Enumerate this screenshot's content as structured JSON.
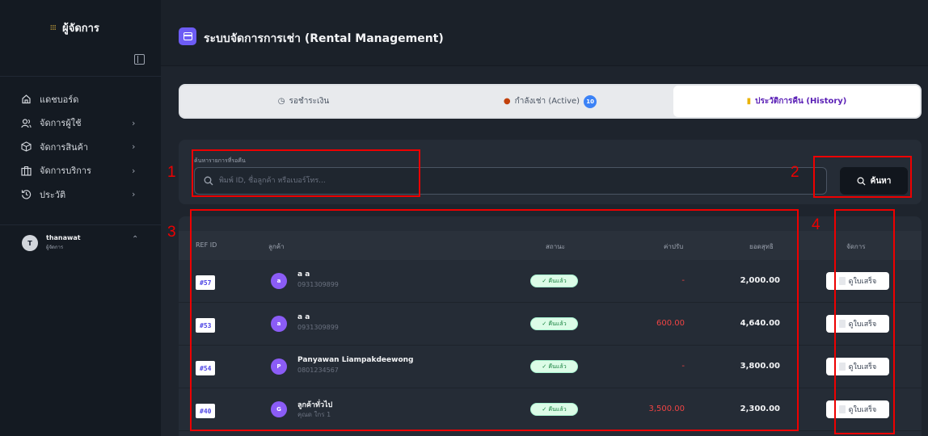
{
  "sidebar": {
    "brand_title": "ผู้จัดการ",
    "brand_logo_glyph": "𝍖",
    "items": [
      {
        "label": "แดชบอร์ด",
        "icon": "home-icon",
        "chevron": ""
      },
      {
        "label": "จัดการผู้ใช้",
        "icon": "users-icon",
        "chevron": "›"
      },
      {
        "label": "จัดการสินค้า",
        "icon": "box-icon",
        "chevron": "›"
      },
      {
        "label": "จัดการบริการ",
        "icon": "services-icon",
        "chevron": "›"
      },
      {
        "label": "ประวัติ",
        "icon": "history-icon",
        "chevron": "›"
      }
    ],
    "user": {
      "initial": "T",
      "name": "thanawat",
      "role": "ผู้จัดการ",
      "chevron": "⌃"
    }
  },
  "header": {
    "title": "ระบบจัดการการเช่า (Rental Management)"
  },
  "tabs": [
    {
      "label": "รอชำระเงิน",
      "icon": "clock-icon",
      "icon_glyph": "◷",
      "badge": ""
    },
    {
      "label": "กำลังเช่า (Active)",
      "icon": "package-icon",
      "icon_glyph": "●",
      "badge": "10"
    },
    {
      "label": "ประวัติการคืน (History)",
      "icon": "scroll-icon",
      "icon_glyph": "▮",
      "badge": ""
    }
  ],
  "search": {
    "label": "ค้นหารายการที่รอคืน",
    "placeholder": "พิมพ์ ID, ชื่อลูกค้า หรือเบอร์โทร...",
    "value": "",
    "button_label": "ค้นหา"
  },
  "table": {
    "headers": {
      "ref": "REF ID",
      "customer": "ลูกค้า",
      "status": "สถานะ",
      "fine": "ค่าปรับ",
      "total": "ยอดสุทธิ",
      "actions": "จัดการ"
    },
    "receipt_label": "ดูใบเสร็จ",
    "rows": [
      {
        "ref": "#57",
        "avatar": "a",
        "avatar_color": "#8b5cf6",
        "name": "a a",
        "sub": "0931309899",
        "status": "✓ คืนแล้ว",
        "fine": "-",
        "total": "2,000.00"
      },
      {
        "ref": "#53",
        "avatar": "a",
        "avatar_color": "#8b5cf6",
        "name": "a a",
        "sub": "0931309899",
        "status": "✓ คืนแล้ว",
        "fine": "600.00",
        "total": "4,640.00"
      },
      {
        "ref": "#54",
        "avatar": "P",
        "avatar_color": "#8b5cf6",
        "name": "Panyawan Liampakdeewong",
        "sub": "0801234567",
        "status": "✓ คืนแล้ว",
        "fine": "-",
        "total": "3,800.00"
      },
      {
        "ref": "#40",
        "avatar": "G",
        "avatar_color": "#8b5cf6",
        "name": "ลูกค้าทั่วไป",
        "sub": "คุณด ใกร 1",
        "status": "✓ คืนแล้ว",
        "fine": "3,500.00",
        "total": "2,300.00"
      }
    ]
  },
  "annotations": [
    "1",
    "2",
    "3",
    "4"
  ],
  "colors": {
    "accent": "#6d5cf5",
    "annotation": "#ee0000",
    "fine": "#ef4444",
    "status_bg": "#dcfce7"
  }
}
